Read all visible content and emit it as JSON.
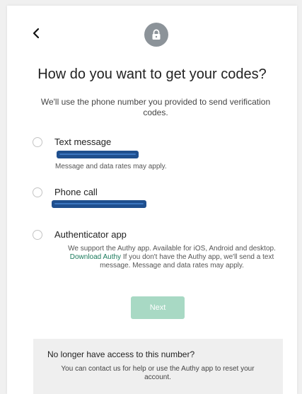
{
  "header": {
    "back_icon": "chevron-left-icon",
    "badge_icon": "lock-icon",
    "title": "How do you want to get your codes?",
    "subtitle": "We'll use the phone number you provided to send verification codes."
  },
  "options": [
    {
      "label": "Text message",
      "value_redacted": true,
      "note": "Message and data rates may apply."
    },
    {
      "label": "Phone call",
      "value_redacted": true
    },
    {
      "label": "Authenticator app",
      "desc_before": "We support the Authy app. Available for iOS, Android and desktop.",
      "link": "Download Authy",
      "desc_after": "If you don't have the Authy app, we'll send a text message. Message and data rates may apply."
    }
  ],
  "next_label": "Next",
  "help": {
    "title": "No longer have access to this number?",
    "text": "You can contact us for help or use the Authy app to reset your account."
  },
  "colors": {
    "accent": "#1a7a5c",
    "button_disabled": "#a8d9c4",
    "badge": "#8c9399",
    "redaction": "#1f4f8e"
  }
}
